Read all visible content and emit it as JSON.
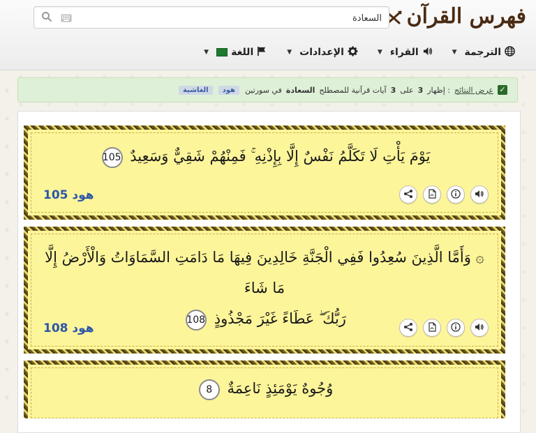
{
  "app": {
    "title": "فهرس القرآن"
  },
  "search": {
    "value": "السعادة"
  },
  "menu": {
    "items": [
      {
        "label": "الترجمة"
      },
      {
        "label": "القراء"
      },
      {
        "label": "الإعدادات"
      },
      {
        "label": "اللغة"
      }
    ]
  },
  "notice": {
    "link": "عرض النتائج",
    "text_1": ": إظهار",
    "count": "3",
    "text_2": "على",
    "total": "3",
    "text_3": "آيات قرآنية للمصطلح",
    "term": "السعادة",
    "text_4": "في سورتين",
    "surahs": [
      "هود",
      "الغاشية"
    ]
  },
  "verses": [
    {
      "text": "يَوْمَ يَأْتِ لَا تَكَلَّمُ نَفْسٌ إِلَّا بِإِذْنِهِ ۚ فَمِنْهُمْ شَقِيٌّ وَسَعِيدٌ",
      "number": "105",
      "ref": "هود 105"
    },
    {
      "text_line1": "۞ وَأَمَّا الَّذِينَ سُعِدُوا فَفِي الْجَنَّةِ خَالِدِينَ فِيهَا مَا دَامَتِ السَّمَاوَاتُ وَالْأَرْضُ إِلَّا مَا شَاءَ",
      "text_line2": "رَبُّكَ ۖ عَطَاءً غَيْرَ مَجْذُوذٍ",
      "number": "108",
      "ref": "هود 108"
    },
    {
      "text": "وُجُوهٌ يَوْمَئِذٍ نَاعِمَةٌ",
      "number": "8"
    }
  ],
  "colors": {
    "accent": "#2c57a8",
    "card_bg": "#fdf59a",
    "notice_bg": "#dff0d8",
    "brand": "#4a2a12"
  },
  "icons": {
    "actions": [
      "audio-icon",
      "info-icon",
      "pdf-icon",
      "share-icon"
    ]
  }
}
